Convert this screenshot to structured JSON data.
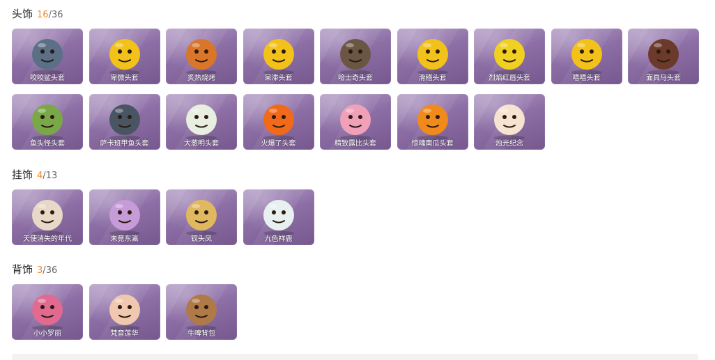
{
  "sections": [
    {
      "name": "头饰",
      "count": "16",
      "total": "36",
      "items": [
        {
          "label": "咬咬鲨头套",
          "icon": "shark-head-icon",
          "color": "#5b6f86"
        },
        {
          "label": "卑微头套",
          "icon": "sad-emoji-head-icon",
          "color": "#f3c21a"
        },
        {
          "label": "炙热烧烤",
          "icon": "bbq-meat-head-icon",
          "color": "#d9762a"
        },
        {
          "label": "呆滞头套",
          "icon": "dazed-emoji-head-icon",
          "color": "#f3c21a"
        },
        {
          "label": "哈士奇头套",
          "icon": "husky-dog-head-icon",
          "color": "#6b5644"
        },
        {
          "label": "滑稽头套",
          "icon": "funny-emoji-head-icon",
          "color": "#f3c21a"
        },
        {
          "label": "烈焰红唇头套",
          "icon": "pikachu-head-icon",
          "color": "#f0d020"
        },
        {
          "label": "嘻嘻头套",
          "icon": "grin-emoji-head-icon",
          "color": "#f3c21a"
        },
        {
          "label": "面具马头套",
          "icon": "horse-head-icon",
          "color": "#6b3a2a"
        },
        {
          "label": "鱼头怪头套",
          "icon": "fish-monster-head-icon",
          "color": "#7aa848"
        },
        {
          "label": "萨卡班甲鱼头套",
          "icon": "sacabambaspis-head-icon",
          "color": "#4a5563"
        },
        {
          "label": "大葱明头套",
          "icon": "green-onion-head-icon",
          "color": "#e8eee0"
        },
        {
          "label": "火爆了头套",
          "icon": "fire-head-icon",
          "color": "#f06a1a"
        },
        {
          "label": "精致露比头套",
          "icon": "pink-pig-head-icon",
          "color": "#f0a0b8"
        },
        {
          "label": "惊魂南瓜头套",
          "icon": "pumpkin-head-icon",
          "color": "#f08a1a"
        },
        {
          "label": "烛光纪念",
          "icon": "candle-head-icon",
          "color": "#f6e4d0"
        }
      ]
    },
    {
      "name": "挂饰",
      "count": "4",
      "total": "13",
      "items": [
        {
          "label": "天使消失的年代",
          "icon": "angel-doll-icon",
          "color": "#e8d8c8"
        },
        {
          "label": "未竟东瀛",
          "icon": "anime-girl-doll-icon",
          "color": "#c79ad8"
        },
        {
          "label": "钗头凤",
          "icon": "phoenix-crown-doll-icon",
          "color": "#e0b860"
        },
        {
          "label": "九色祥鹿",
          "icon": "nine-color-deer-icon",
          "color": "#e8f0f0"
        }
      ]
    },
    {
      "name": "背饰",
      "count": "3",
      "total": "36",
      "items": [
        {
          "label": "小小罗丽",
          "icon": "princess-doll-icon",
          "color": "#e06a90"
        },
        {
          "label": "梵音莲华",
          "icon": "lotus-girl-doll-icon",
          "color": "#f0c8b0"
        },
        {
          "label": "牛啤背包",
          "icon": "cow-beer-backpack-icon",
          "color": "#b07a48"
        }
      ]
    }
  ]
}
